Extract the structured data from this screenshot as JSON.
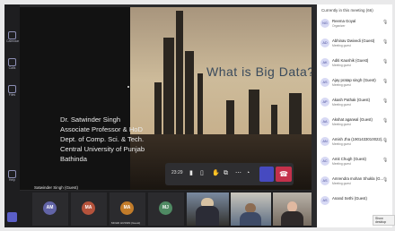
{
  "rail": {
    "items": [
      {
        "label": "Calendar",
        "icon": "calendar-icon"
      },
      {
        "label": "Calls",
        "icon": "phone-icon"
      },
      {
        "label": "Files",
        "icon": "files-icon"
      },
      {
        "label": "Apps",
        "icon": "apps-icon"
      },
      {
        "label": "Help",
        "icon": "help-icon"
      }
    ]
  },
  "slide": {
    "title_part1": "What is Big",
    "title_part2": "Data?",
    "presenter_lines": [
      "Dr. Satwinder Singh",
      "Associate Professor & HoD",
      "Dept. of Comp. Sci. & Tech.",
      "Central University of Punjab",
      "Bathinda"
    ],
    "speaker_caption": "Satwinder Singh (Guest)"
  },
  "controls": {
    "timer": "23:29",
    "colors": {
      "camera": "#464ac0",
      "leave": "#c4314b"
    }
  },
  "strip": {
    "tiles": [
      {
        "initials": "AM",
        "name": "",
        "color": "#6264a7"
      },
      {
        "initials": "MA",
        "name": "",
        "color": "#b5533c"
      },
      {
        "initials": "MA",
        "name": "MOHD HUSSIN (Guest)",
        "color": "#c27c2a"
      },
      {
        "initials": "MJ",
        "name": "",
        "color": "#4f8a63"
      }
    ]
  },
  "roster": {
    "header": "Currently in this meeting (66)",
    "items": [
      {
        "initials": "NG",
        "name": "Reema Goyal",
        "role": "Organizer"
      },
      {
        "initials": "AD",
        "name": "Abhinav Dwivedi (Guest)",
        "role": "Meeting guest"
      },
      {
        "initials": "AK",
        "name": "Aditi Kaushik (Guest)",
        "role": "Meeting guest"
      },
      {
        "initials": "AS",
        "name": "Ajay pratap singh (Guest)",
        "role": "Meeting guest"
      },
      {
        "initials": "AP",
        "name": "Akash Pathak (Guest)",
        "role": "Meeting guest"
      },
      {
        "initials": "AA",
        "name": "Akshat agarwal (Guest)",
        "role": "Meeting guest"
      },
      {
        "initials": "AN",
        "name": "Amish Jha (1901433010022)...",
        "role": "Meeting guest"
      },
      {
        "initials": "AC",
        "name": "Amit Chugh (Guest)",
        "role": "Meeting guest"
      },
      {
        "initials": "AS",
        "name": "Amrendra mohan Shukla (G...",
        "role": "Meeting guest"
      },
      {
        "initials": "AS",
        "name": "Anand Sethi (Guest)",
        "role": ""
      }
    ],
    "tooltip": "Show desktop"
  }
}
